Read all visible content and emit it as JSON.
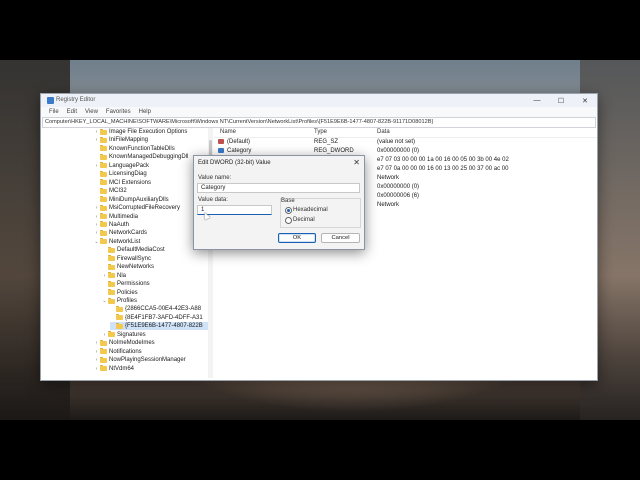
{
  "window": {
    "title": "Registry Editor",
    "controls": {
      "minimize": "—",
      "maximize": "☐",
      "close": "✕"
    }
  },
  "menu": [
    "File",
    "Edit",
    "View",
    "Favorites",
    "Help"
  ],
  "address": "Computer\\HKEY_LOCAL_MACHINE\\SOFTWARE\\Microsoft\\Windows NT\\CurrentVersion\\NetworkList\\Profiles\\{F51E9E6B-1477-4807-822B-91171D08012B}",
  "tree": [
    {
      "label": "Image File Execution Options",
      "indent": 0,
      "exp": "›"
    },
    {
      "label": "IniFileMapping",
      "indent": 0,
      "exp": "›"
    },
    {
      "label": "KnownFunctionTableDlls",
      "indent": 0,
      "exp": ""
    },
    {
      "label": "KnownManagedDebuggingDll",
      "indent": 0,
      "exp": ""
    },
    {
      "label": "LanguagePack",
      "indent": 0,
      "exp": "›"
    },
    {
      "label": "LicensingDiag",
      "indent": 0,
      "exp": ""
    },
    {
      "label": "MCI Extensions",
      "indent": 0,
      "exp": ""
    },
    {
      "label": "MCI32",
      "indent": 0,
      "exp": ""
    },
    {
      "label": "MiniDumpAuxiliaryDlls",
      "indent": 0,
      "exp": ""
    },
    {
      "label": "MsiCorruptedFileRecovery",
      "indent": 0,
      "exp": "›"
    },
    {
      "label": "Multimedia",
      "indent": 0,
      "exp": "›"
    },
    {
      "label": "NaAuth",
      "indent": 0,
      "exp": "›"
    },
    {
      "label": "NetworkCards",
      "indent": 0,
      "exp": "›"
    },
    {
      "label": "NetworkList",
      "indent": 0,
      "exp": "⌄"
    },
    {
      "label": "DefaultMediaCost",
      "indent": 1,
      "exp": ""
    },
    {
      "label": "FirewallSync",
      "indent": 1,
      "exp": ""
    },
    {
      "label": "NewNetworks",
      "indent": 1,
      "exp": ""
    },
    {
      "label": "Nla",
      "indent": 1,
      "exp": "›"
    },
    {
      "label": "Permissions",
      "indent": 1,
      "exp": ""
    },
    {
      "label": "Policies",
      "indent": 1,
      "exp": ""
    },
    {
      "label": "Profiles",
      "indent": 1,
      "exp": "⌄"
    },
    {
      "label": "{2866CCA5-00E4-42E3-A88",
      "indent": 2,
      "exp": ""
    },
    {
      "label": "{8E4F1FB7-3AFD-4DFF-A31",
      "indent": 2,
      "exp": ""
    },
    {
      "label": "{F51E9E6B-1477-4807-822B",
      "indent": 2,
      "exp": "",
      "selected": true
    },
    {
      "label": "Signatures",
      "indent": 1,
      "exp": "›"
    },
    {
      "label": "NoImeModeImes",
      "indent": 0,
      "exp": "›"
    },
    {
      "label": "Notifications",
      "indent": 0,
      "exp": "›"
    },
    {
      "label": "NowPlayingSessionManager",
      "indent": 0,
      "exp": "›"
    },
    {
      "label": "NtVdm64",
      "indent": 0,
      "exp": "›"
    }
  ],
  "list": {
    "headers": {
      "name": "Name",
      "type": "Type",
      "data": "Data"
    },
    "rows": [
      {
        "name": "(Default)",
        "type": "REG_SZ",
        "data": "(value not set)",
        "icon": "string-value-icon",
        "color": "#c0504d"
      },
      {
        "name": "Category",
        "type": "REG_DWORD",
        "data": "0x00000000 (0)",
        "icon": "binary-value-icon",
        "color": "#3b79c9"
      },
      {
        "name": "",
        "type": "",
        "data": "e7 07 03 00 00 00 1a 00 16 00 05 00 3b 00 4e 02"
      },
      {
        "name": "",
        "type": "",
        "data": "e7 07 0a 00 00 00 16 00 13 00 25 00 37 00 ac 00"
      },
      {
        "name": "",
        "type": "",
        "data": "Network"
      },
      {
        "name": "",
        "type": "",
        "data": "0x00000000 (0)"
      },
      {
        "name": "",
        "type": "",
        "data": "0x00000006 (6)"
      },
      {
        "name": "",
        "type": "",
        "data": "Network"
      }
    ]
  },
  "dialog": {
    "title": "Edit DWORD (32-bit) Value",
    "value_name_label": "Value name:",
    "value_name": "Category",
    "value_data_label": "Value data:",
    "value_data": "1",
    "base_label": "Base",
    "hex_label": "Hexadecimal",
    "dec_label": "Decimal",
    "ok": "OK",
    "cancel": "Cancel",
    "close": "✕"
  }
}
